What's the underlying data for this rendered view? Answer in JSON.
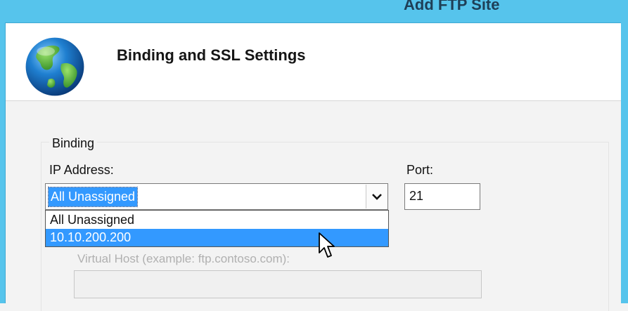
{
  "window": {
    "title": "Add FTP Site"
  },
  "header": {
    "title": "Binding and SSL Settings",
    "icon": "globe-icon"
  },
  "binding": {
    "group_label": "Binding",
    "ip_address_label": "IP Address:",
    "ip_address_value": "All Unassigned",
    "ip_address_options": [
      "All Unassigned",
      "10.10.200.200"
    ],
    "highlighted_option": "10.10.200.200",
    "port_label": "Port:",
    "port_value": "21",
    "virtual_host_label": "Virtual Host (example: ftp.contoso.com):",
    "virtual_host_value": ""
  },
  "colors": {
    "titlebar": "#56c4ec",
    "selection": "#3399ff",
    "background": "#f3f3f3"
  }
}
